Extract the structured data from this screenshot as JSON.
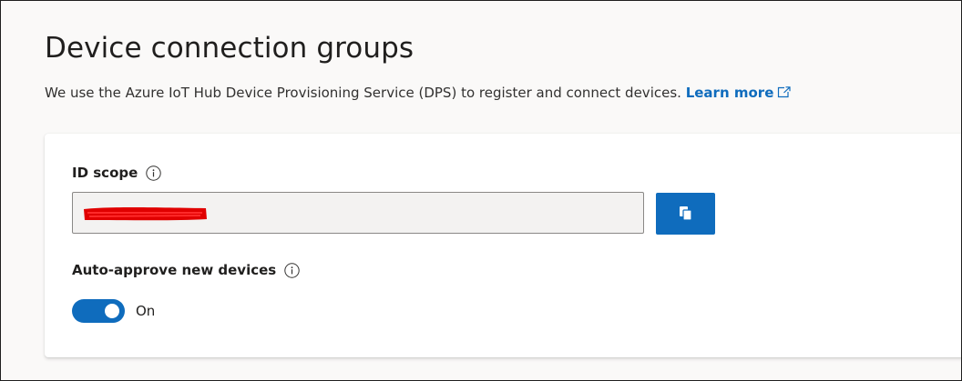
{
  "header": {
    "title": "Device connection groups",
    "description": "We use the Azure IoT Hub Device Provisioning Service (DPS) to register and connect devices.",
    "learn_more_label": "Learn more"
  },
  "id_scope": {
    "label": "ID scope",
    "value": "",
    "value_redacted": true,
    "copy_icon": "copy-icon",
    "info_icon": "info-icon"
  },
  "auto_approve": {
    "label": "Auto-approve new devices",
    "info_icon": "info-icon",
    "toggle_state": "On",
    "enabled": true
  },
  "colors": {
    "accent": "#0f6cbd",
    "redaction": "#e00000",
    "input_background": "#f3f2f1"
  }
}
